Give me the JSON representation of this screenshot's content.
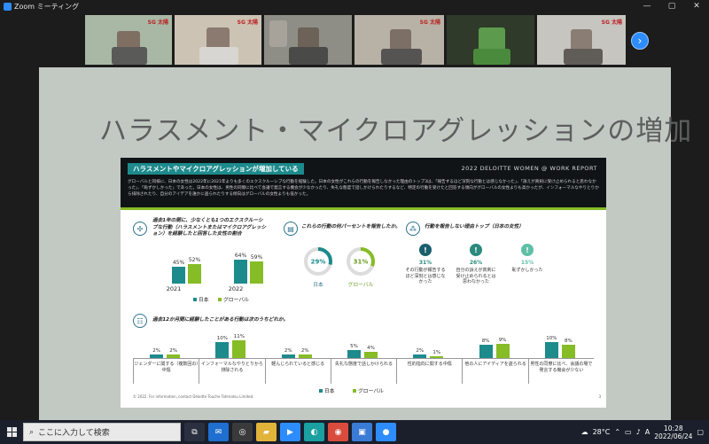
{
  "window": {
    "title": "Zoom ミーティング",
    "minimize": "—",
    "maximize": "▢",
    "close": "✕"
  },
  "participants": {
    "logo_text": "SG 太陽",
    "next_icon": "chevron-right-icon",
    "tiles": [
      {
        "bg": "#a8b8a4"
      },
      {
        "bg": "#cdc3b4"
      },
      {
        "bg": "#8e8e86"
      },
      {
        "bg": "#b8b1a6"
      },
      {
        "bg": "#2f3a2a"
      },
      {
        "bg": "#c7c5bf"
      }
    ]
  },
  "slide": {
    "title": "ハラスメント・マイクロアグレッションの増加",
    "background": "#c2c9c3",
    "report": {
      "header_badge": "ハラスメントやマイクロアグレッションが増加している",
      "brand": "2022 DELOITTE WOMEN @ WORK REPORT",
      "description": "グローバルと同様に、日本の女性は2022年に2021年よりも多くのエクスクルーシブな行動を経験した。日本の女性がこれらの行動を報告しなかった理由のトップ3は、「報告するほど深刻な行動とは感じなかった」、「訴えが真剣に受け止められると思わなかった」、「恥ずかしかった」であった。日本の女性は、男性の同僚に比べて会議で発言する機会が少なかったり、失礼な態度で話しかけられたりするなど、特定の行動を受けたと回答する傾向がグローバルの女性よりも高かったが、インフォーマルなやりとりから排除されたり、自分のアイデアを誰かに盗られたりする傾向はグローバルの女性よりも低かった。",
      "accent_teal": "#1d8a8c",
      "accent_green": "#86bc25",
      "section1": {
        "icon": "network-icon",
        "question": "過去1年の間に、少なくとも1つのエクスクルーシブな行動（ハラスメントまたはマイクロアグレッション）を経験したと回答した女性の割合",
        "legend_japan": "日本",
        "legend_global": "グローバル"
      },
      "section2": {
        "icon": "document-icon",
        "question": "これらの行動の何パーセントを報告したか。",
        "japan_label": "日本",
        "global_label": "グローバル"
      },
      "section3": {
        "icon": "group-icon",
        "question": "行動を報告しない理由トップ（日本の女性）",
        "reasons": [
          {
            "pct": "31%",
            "text": "その行動が報告するほど深刻とは感じなかった",
            "color": "#1b5e6e",
            "icon": "exclamation-icon"
          },
          {
            "pct": "26%",
            "text": "自分の訴えが真剣に受け止められるとは思わなかった",
            "color": "#2b8a7e",
            "icon": "exclamation-icon"
          },
          {
            "pct": "15%",
            "text": "恥ずかしかった",
            "color": "#5fbfa8",
            "icon": "exclamation-icon"
          }
        ]
      },
      "section4": {
        "icon": "chat-icon",
        "question": "過去12か月間に経験したことがある行動は次のうちどれか。",
        "legend_japan": "日本",
        "legend_global": "グローバル"
      },
      "footnote": "© 2022. For information, contact Deloitte Touche Tohmatsu Limited.",
      "page_number": "3"
    }
  },
  "chart_data": [
    {
      "type": "bar",
      "categories": [
        "2021",
        "2022"
      ],
      "series": [
        {
          "name": "日本",
          "values": [
            45,
            64
          ],
          "labels": [
            "45%",
            "64%"
          ]
        },
        {
          "name": "グローバル",
          "values": [
            52,
            59
          ],
          "labels": [
            "52%",
            "59%"
          ]
        }
      ]
    },
    {
      "type": "pie",
      "series": [
        {
          "name": "日本",
          "value": 29,
          "label": "29%"
        },
        {
          "name": "グローバル",
          "value": 31,
          "label": "31%"
        }
      ]
    },
    {
      "type": "bar",
      "categories": [
        "ジェンダーに関する（複数回の）中傷",
        "インフォーマルなやりとりから排除される",
        "軽んじられていると感じる",
        "失礼な態度で話しかけられる",
        "性的指向に関する中傷",
        "他の人にアイディアを盗られる",
        "男性の同僚に比べ、会議の場で発言する機会が少ない"
      ],
      "series": [
        {
          "name": "日本",
          "values": [
            2,
            10,
            2,
            5,
            2,
            8,
            10
          ],
          "labels": [
            "2%",
            "10%",
            "2%",
            "5%",
            "2%",
            "8%",
            "10%"
          ]
        },
        {
          "name": "グローバル",
          "values": [
            2,
            11,
            2,
            4,
            1,
            9,
            8
          ],
          "labels": [
            "2%",
            "11%",
            "2%",
            "4%",
            "1%",
            "9%",
            "8%"
          ]
        }
      ]
    }
  ],
  "taskbar": {
    "search_placeholder": "ここに入力して検索",
    "weather": "28°C",
    "ime": "A",
    "time": "10:28",
    "date": "2022/06/24",
    "apps": [
      {
        "icon": "task-view-icon",
        "color": "#2a3040"
      },
      {
        "icon": "mail-icon",
        "color": "#1e6fd0"
      },
      {
        "icon": "dell-icon",
        "color": "#3a3a3a"
      },
      {
        "icon": "file-explorer-icon",
        "color": "#e2b33a"
      },
      {
        "icon": "video-icon",
        "color": "#2d8cff"
      },
      {
        "icon": "edge-icon",
        "color": "#1aa0a0"
      },
      {
        "icon": "chrome-icon",
        "color": "#d94c3d"
      },
      {
        "icon": "photos-icon",
        "color": "#3a7bd5"
      },
      {
        "icon": "zoom-icon",
        "color": "#2d8cff"
      }
    ]
  }
}
